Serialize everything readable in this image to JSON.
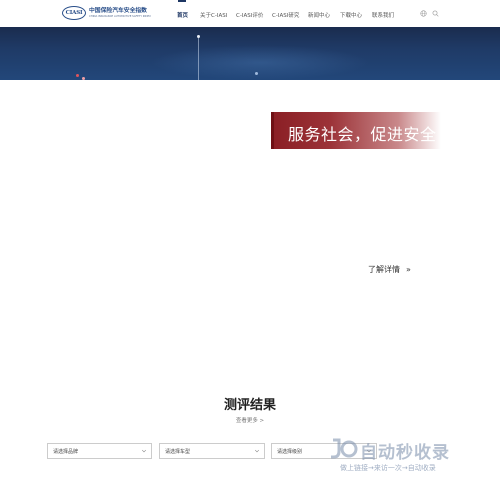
{
  "header": {
    "logo": {
      "mark": "CIASI",
      "name_cn": "中国保险汽车安全指数",
      "name_en": "CHINA INSURANCE AUTOMOTIVE SAFETY INDEX"
    },
    "nav": [
      {
        "label": "首页",
        "active": true
      },
      {
        "label": "关于C-IASI",
        "active": false
      },
      {
        "label": "C-IASI评价",
        "active": false
      },
      {
        "label": "C-IASI研究",
        "active": false
      },
      {
        "label": "新闻中心",
        "active": false
      },
      {
        "label": "下载中心",
        "active": false
      },
      {
        "label": "联系我们",
        "active": false
      }
    ],
    "icons": [
      "globe-icon",
      "search-icon"
    ]
  },
  "slogan": {
    "text": "服务社会，促进安全"
  },
  "learn_more": {
    "label": "了解详情",
    "chevron": "»"
  },
  "results": {
    "title": "测评结果",
    "more": "查看更多 >",
    "filters": [
      {
        "placeholder": "请选择品牌"
      },
      {
        "placeholder": "请选择车型"
      },
      {
        "placeholder": "请选择级别"
      }
    ]
  },
  "watermark": {
    "title": "自动秒收录",
    "subtitle": "做上链接→来访一次→自动收录"
  },
  "colors": {
    "brand_navy": "#1d3663",
    "slogan_red": "#8a1e24"
  }
}
